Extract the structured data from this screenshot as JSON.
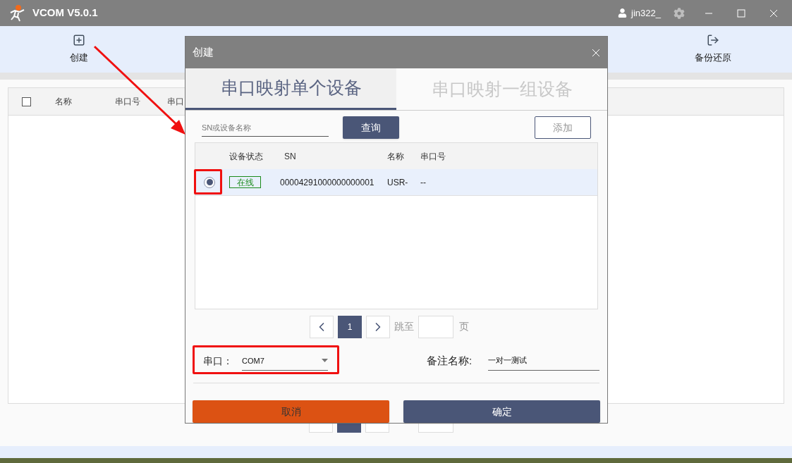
{
  "window": {
    "title": "VCOM V5.0.1",
    "user": "jin322_"
  },
  "toolbar": [
    {
      "label": "创建",
      "kind": "create"
    },
    {
      "label": "备份还原",
      "kind": "backup"
    }
  ],
  "table": {
    "select_all_checked": false,
    "columns": [
      "名称",
      "串口号",
      "串口"
    ]
  },
  "dialog": {
    "title": "创建",
    "tabs": [
      {
        "label": "串口映射单个设备",
        "selected": true
      },
      {
        "label": "串口映射一组设备",
        "selected": false
      }
    ],
    "search": {
      "placeholder": "SN或设备名称"
    },
    "query_button": "查询",
    "add_button": "添加",
    "columns": [
      "设备状态",
      "SN",
      "名称",
      "串口号"
    ],
    "rows": [
      {
        "selected": true,
        "status": "在线",
        "color": "#1a8a1a",
        "sn": "00004291000000000001",
        "name": "USR-",
        "port": "--"
      }
    ],
    "pagination": {
      "page": "1",
      "jump_label": "跳至",
      "page_suffix": "页"
    },
    "serial": {
      "label": "串口：",
      "value": "COM7"
    },
    "remark": {
      "label": "备注名称:",
      "value": "一对一测试"
    },
    "cancel_button": "取消",
    "confirm_button": "确定"
  }
}
